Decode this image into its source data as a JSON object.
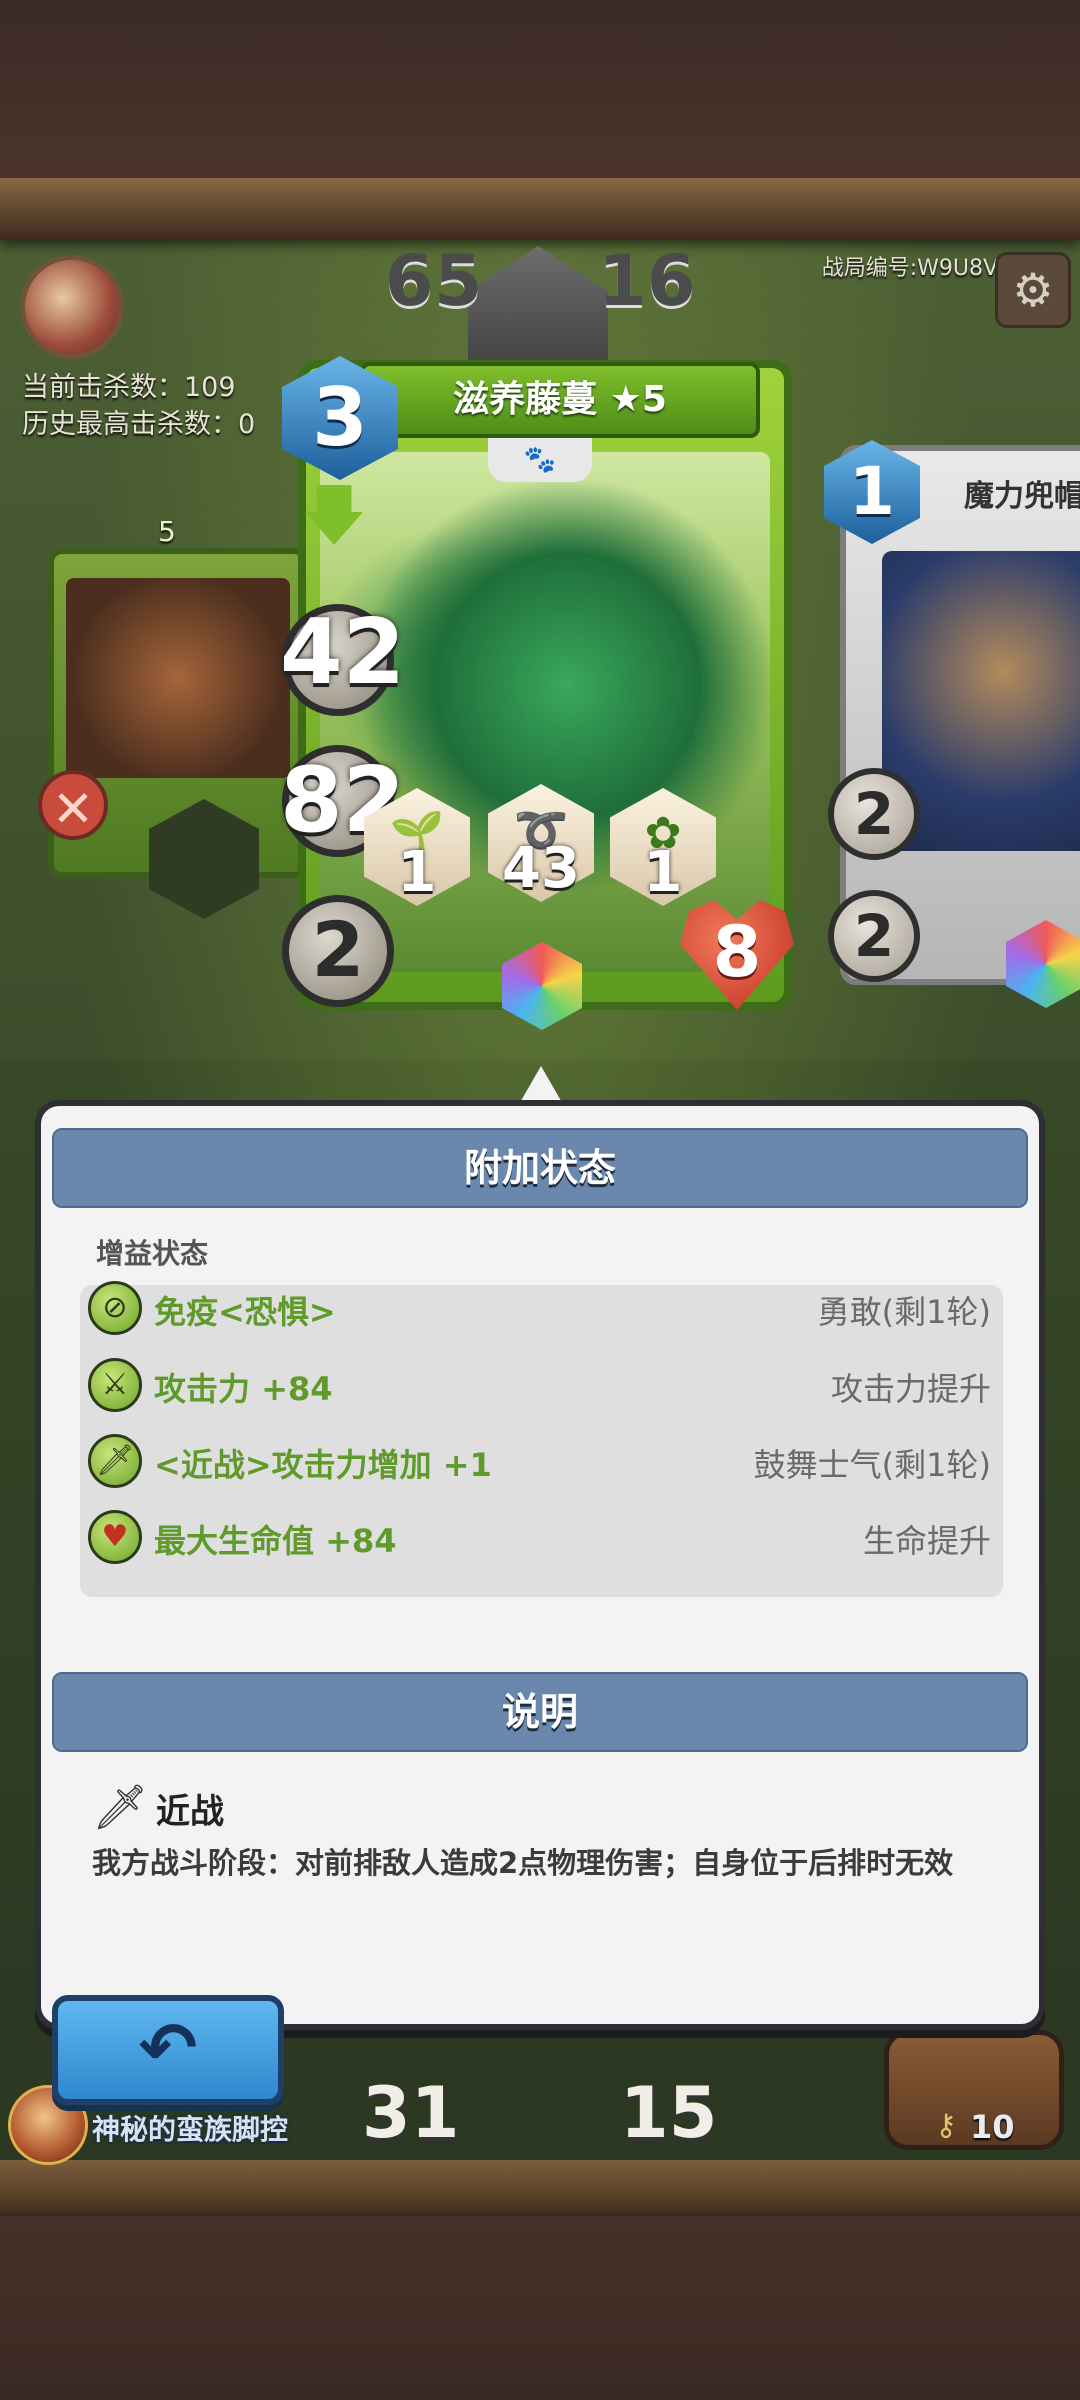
{
  "hud": {
    "kills_current": "当前击杀数：109",
    "kills_best": "历史最高击杀数：0",
    "battle_id": "战局编号:W9U8V",
    "enemy_hp_left": "65",
    "enemy_hp_right": "16",
    "player_hp_left": "31",
    "player_hp_right": "15",
    "opponent_name": "神秘的蛮族脚控",
    "deck_count": "10"
  },
  "side_cards": {
    "left_level": "5",
    "right_name": "魔力兜帽",
    "right_cost": "1",
    "right_dice": "2",
    "right_attack": "2"
  },
  "card": {
    "name": "滋养藤蔓 ★5",
    "cost": "3",
    "health": "42",
    "dice": "82",
    "attack": "2",
    "badges": [
      "1",
      "43",
      "1"
    ],
    "heart_value": "8"
  },
  "popup": {
    "status_title": "附加状态",
    "buff_heading": "增益状态",
    "buffs": [
      {
        "effect": "免疫<恐惧>",
        "source": "勇敢(剩1轮)",
        "icon": "immune-icon"
      },
      {
        "effect": "攻击力 +84",
        "source": "攻击力提升",
        "icon": "attack-up-icon"
      },
      {
        "effect": "<近战>攻击力增加 +1",
        "source": "鼓舞士气(剩1轮)",
        "icon": "melee-icon"
      },
      {
        "effect": "最大生命值 +84",
        "source": "生命提升",
        "icon": "heart-icon"
      }
    ],
    "desc_title": "说明",
    "skill_name": "近战",
    "skill_desc": "我方战斗阶段：对前排敌人造成2点物理伤害；自身位于后排时无效"
  },
  "colors": {
    "buff_green": "#5f9a2a",
    "section_blue": "#6a88ad",
    "back_blue": "#2f87cf"
  }
}
